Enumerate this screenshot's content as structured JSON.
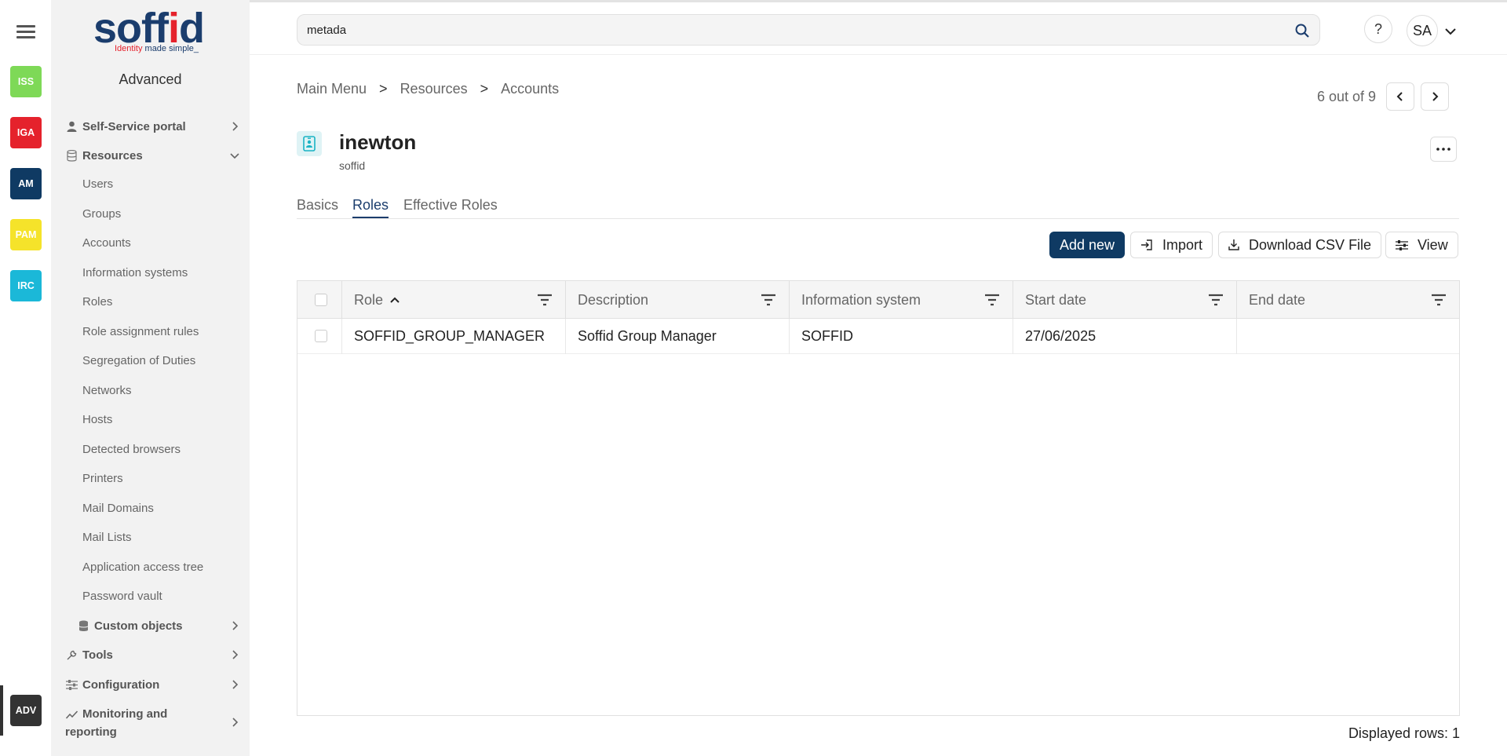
{
  "rail": {
    "buttons": [
      {
        "label": "ISS",
        "color": "#7ed957"
      },
      {
        "label": "IGA",
        "color": "#e5222c"
      },
      {
        "label": "AM",
        "color": "#0f3a63"
      },
      {
        "label": "PAM",
        "color": "#f5e32a"
      },
      {
        "label": "IRC",
        "color": "#1bb8d8"
      },
      {
        "label": "ADV",
        "color": "#333333"
      }
    ]
  },
  "sidebar": {
    "logo_word_a": "soff",
    "logo_word_b": "i",
    "logo_word_c": "d",
    "logo_tag_a": "Identity",
    "logo_tag_b": " made simple_",
    "title": "Advanced",
    "groups": {
      "self_service": "Self-Service portal",
      "resources": "Resources",
      "custom_objects": "Custom objects",
      "tools": "Tools",
      "configuration": "Configuration",
      "monitoring": "Monitoring and reporting"
    },
    "items": [
      "Users",
      "Groups",
      "Accounts",
      "Information systems",
      "Roles",
      "Role assignment rules",
      "Segregation of Duties",
      "Networks",
      "Hosts",
      "Detected browsers",
      "Printers",
      "Mail Domains",
      "Mail Lists",
      "Application access tree",
      "Password vault"
    ]
  },
  "topbar": {
    "search_value": "metada",
    "help": "?",
    "user_initials": "SA"
  },
  "breadcrumb": {
    "items": [
      "Main Menu",
      "Resources",
      "Accounts"
    ],
    "sep": ">"
  },
  "pager": {
    "text": "6 out of 9"
  },
  "account": {
    "name": "inewton",
    "system": "soffid"
  },
  "tabs": [
    "Basics",
    "Roles",
    "Effective Roles"
  ],
  "toolbar": {
    "add_new": "Add new",
    "import": "Import",
    "download": "Download CSV File",
    "view": "View"
  },
  "table": {
    "columns": [
      "Role",
      "Description",
      "Information system",
      "Start date",
      "End date"
    ],
    "rows": [
      [
        "SOFFID_GROUP_MANAGER",
        "Soffid Group Manager",
        "SOFFID",
        "27/06/2025",
        ""
      ]
    ]
  },
  "footer": {
    "displayed_rows": "Displayed rows: 1"
  }
}
